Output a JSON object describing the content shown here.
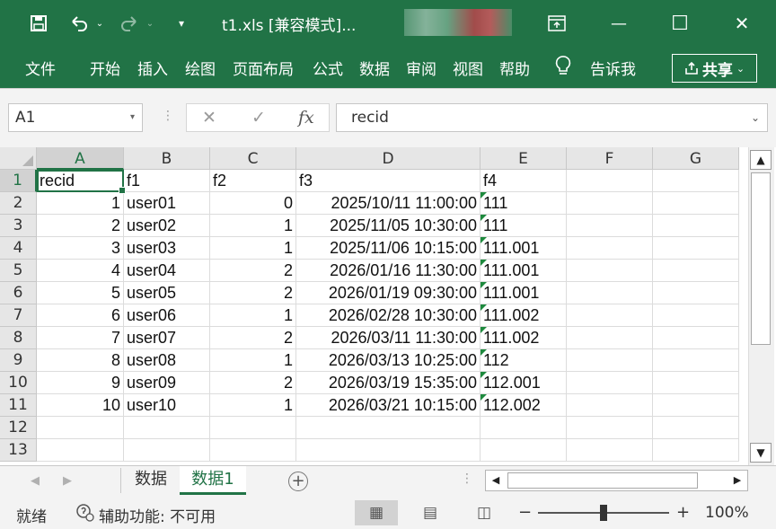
{
  "title": "t1.xls  [兼容模式]...",
  "title_icons": {
    "save": "save-icon",
    "undo": "undo-icon",
    "redo": "redo-icon",
    "customize": "customize-qat-icon"
  },
  "window_controls": {
    "restore_ribbon": "ribbon-display-icon",
    "minimize": "—",
    "maximize": "☐",
    "close": "✕"
  },
  "ribbon_tabs": [
    "文件",
    "开始",
    "插入",
    "绘图",
    "页面布局",
    "公式",
    "数据",
    "审阅",
    "视图",
    "帮助"
  ],
  "tell_me": "告诉我",
  "share": "共享",
  "name_box": "A1",
  "formula_value": "recid",
  "formula_icons": {
    "cancel": "✕",
    "enter": "✓",
    "fx": "fx"
  },
  "columns": [
    "A",
    "B",
    "C",
    "D",
    "E",
    "F",
    "G"
  ],
  "rows": [
    "1",
    "2",
    "3",
    "4",
    "5",
    "6",
    "7",
    "8",
    "9",
    "10",
    "11",
    "12",
    "13"
  ],
  "table": {
    "header": [
      "recid",
      "f1",
      "f2",
      "f3",
      "f4"
    ],
    "data": [
      [
        "1",
        "user01",
        "0",
        "2025/10/11 11:00:00",
        "111"
      ],
      [
        "2",
        "user02",
        "1",
        "2025/11/05 10:30:00",
        "111"
      ],
      [
        "3",
        "user03",
        "1",
        "2025/11/06 10:15:00",
        "111.001"
      ],
      [
        "4",
        "user04",
        "2",
        "2026/01/16 11:30:00",
        "111.001"
      ],
      [
        "5",
        "user05",
        "2",
        "2026/01/19 09:30:00",
        "111.001"
      ],
      [
        "6",
        "user06",
        "1",
        "2026/02/28 10:30:00",
        "111.002"
      ],
      [
        "7",
        "user07",
        "2",
        "2026/03/11 11:30:00",
        "111.002"
      ],
      [
        "8",
        "user08",
        "1",
        "2026/03/13 10:25:00",
        "112"
      ],
      [
        "9",
        "user09",
        "2",
        "2026/03/19 15:35:00",
        "112.001"
      ],
      [
        "10",
        "user10",
        "1",
        "2026/03/21 10:15:00",
        "112.002"
      ]
    ]
  },
  "sheets": [
    "数据",
    "数据1"
  ],
  "active_sheet": "数据1",
  "status": {
    "ready": "就绪",
    "accessibility": "辅助功能: 不可用",
    "zoom": "100%",
    "zoom_minus": "−",
    "zoom_plus": "+"
  },
  "colors": {
    "accent": "#217346",
    "error_triangle": "#1e8a3e"
  }
}
